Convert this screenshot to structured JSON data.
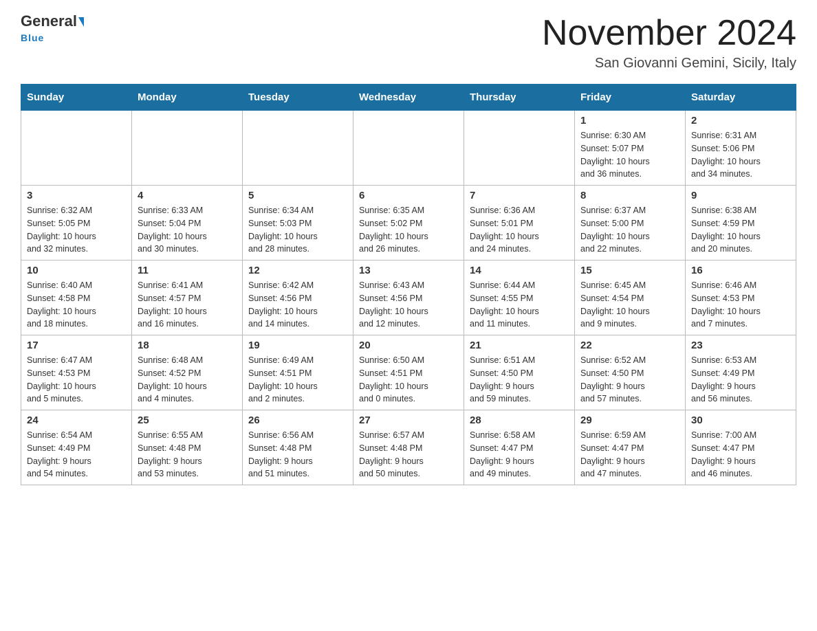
{
  "logo": {
    "text_general": "General",
    "text_blue": "Blue",
    "underline": "Blue"
  },
  "header": {
    "month_title": "November 2024",
    "subtitle": "San Giovanni Gemini, Sicily, Italy"
  },
  "weekdays": [
    "Sunday",
    "Monday",
    "Tuesday",
    "Wednesday",
    "Thursday",
    "Friday",
    "Saturday"
  ],
  "weeks": [
    [
      {
        "day": "",
        "info": ""
      },
      {
        "day": "",
        "info": ""
      },
      {
        "day": "",
        "info": ""
      },
      {
        "day": "",
        "info": ""
      },
      {
        "day": "",
        "info": ""
      },
      {
        "day": "1",
        "info": "Sunrise: 6:30 AM\nSunset: 5:07 PM\nDaylight: 10 hours\nand 36 minutes."
      },
      {
        "day": "2",
        "info": "Sunrise: 6:31 AM\nSunset: 5:06 PM\nDaylight: 10 hours\nand 34 minutes."
      }
    ],
    [
      {
        "day": "3",
        "info": "Sunrise: 6:32 AM\nSunset: 5:05 PM\nDaylight: 10 hours\nand 32 minutes."
      },
      {
        "day": "4",
        "info": "Sunrise: 6:33 AM\nSunset: 5:04 PM\nDaylight: 10 hours\nand 30 minutes."
      },
      {
        "day": "5",
        "info": "Sunrise: 6:34 AM\nSunset: 5:03 PM\nDaylight: 10 hours\nand 28 minutes."
      },
      {
        "day": "6",
        "info": "Sunrise: 6:35 AM\nSunset: 5:02 PM\nDaylight: 10 hours\nand 26 minutes."
      },
      {
        "day": "7",
        "info": "Sunrise: 6:36 AM\nSunset: 5:01 PM\nDaylight: 10 hours\nand 24 minutes."
      },
      {
        "day": "8",
        "info": "Sunrise: 6:37 AM\nSunset: 5:00 PM\nDaylight: 10 hours\nand 22 minutes."
      },
      {
        "day": "9",
        "info": "Sunrise: 6:38 AM\nSunset: 4:59 PM\nDaylight: 10 hours\nand 20 minutes."
      }
    ],
    [
      {
        "day": "10",
        "info": "Sunrise: 6:40 AM\nSunset: 4:58 PM\nDaylight: 10 hours\nand 18 minutes."
      },
      {
        "day": "11",
        "info": "Sunrise: 6:41 AM\nSunset: 4:57 PM\nDaylight: 10 hours\nand 16 minutes."
      },
      {
        "day": "12",
        "info": "Sunrise: 6:42 AM\nSunset: 4:56 PM\nDaylight: 10 hours\nand 14 minutes."
      },
      {
        "day": "13",
        "info": "Sunrise: 6:43 AM\nSunset: 4:56 PM\nDaylight: 10 hours\nand 12 minutes."
      },
      {
        "day": "14",
        "info": "Sunrise: 6:44 AM\nSunset: 4:55 PM\nDaylight: 10 hours\nand 11 minutes."
      },
      {
        "day": "15",
        "info": "Sunrise: 6:45 AM\nSunset: 4:54 PM\nDaylight: 10 hours\nand 9 minutes."
      },
      {
        "day": "16",
        "info": "Sunrise: 6:46 AM\nSunset: 4:53 PM\nDaylight: 10 hours\nand 7 minutes."
      }
    ],
    [
      {
        "day": "17",
        "info": "Sunrise: 6:47 AM\nSunset: 4:53 PM\nDaylight: 10 hours\nand 5 minutes."
      },
      {
        "day": "18",
        "info": "Sunrise: 6:48 AM\nSunset: 4:52 PM\nDaylight: 10 hours\nand 4 minutes."
      },
      {
        "day": "19",
        "info": "Sunrise: 6:49 AM\nSunset: 4:51 PM\nDaylight: 10 hours\nand 2 minutes."
      },
      {
        "day": "20",
        "info": "Sunrise: 6:50 AM\nSunset: 4:51 PM\nDaylight: 10 hours\nand 0 minutes."
      },
      {
        "day": "21",
        "info": "Sunrise: 6:51 AM\nSunset: 4:50 PM\nDaylight: 9 hours\nand 59 minutes."
      },
      {
        "day": "22",
        "info": "Sunrise: 6:52 AM\nSunset: 4:50 PM\nDaylight: 9 hours\nand 57 minutes."
      },
      {
        "day": "23",
        "info": "Sunrise: 6:53 AM\nSunset: 4:49 PM\nDaylight: 9 hours\nand 56 minutes."
      }
    ],
    [
      {
        "day": "24",
        "info": "Sunrise: 6:54 AM\nSunset: 4:49 PM\nDaylight: 9 hours\nand 54 minutes."
      },
      {
        "day": "25",
        "info": "Sunrise: 6:55 AM\nSunset: 4:48 PM\nDaylight: 9 hours\nand 53 minutes."
      },
      {
        "day": "26",
        "info": "Sunrise: 6:56 AM\nSunset: 4:48 PM\nDaylight: 9 hours\nand 51 minutes."
      },
      {
        "day": "27",
        "info": "Sunrise: 6:57 AM\nSunset: 4:48 PM\nDaylight: 9 hours\nand 50 minutes."
      },
      {
        "day": "28",
        "info": "Sunrise: 6:58 AM\nSunset: 4:47 PM\nDaylight: 9 hours\nand 49 minutes."
      },
      {
        "day": "29",
        "info": "Sunrise: 6:59 AM\nSunset: 4:47 PM\nDaylight: 9 hours\nand 47 minutes."
      },
      {
        "day": "30",
        "info": "Sunrise: 7:00 AM\nSunset: 4:47 PM\nDaylight: 9 hours\nand 46 minutes."
      }
    ]
  ]
}
